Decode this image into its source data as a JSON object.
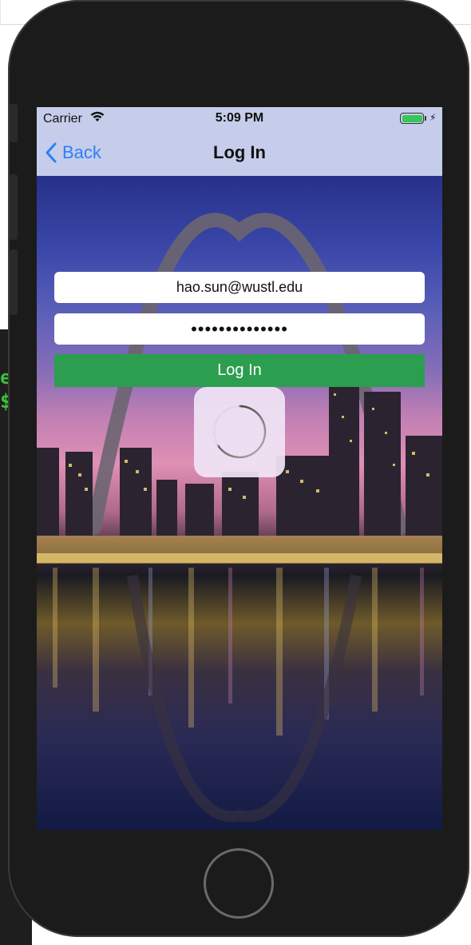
{
  "status_bar": {
    "carrier": "Carrier",
    "time": "5:09 PM"
  },
  "nav": {
    "back_label": "Back",
    "title": "Log In"
  },
  "form": {
    "email_value": "hao.sun@wustl.edu",
    "password_value": "••••••••••••••",
    "login_button_label": "Log In"
  },
  "desktop_terminal": {
    "line1": "e",
    "line2": "$"
  },
  "colors": {
    "nav_bg": "#c5cdea",
    "accent_blue": "#2d7ff9",
    "login_green": "#2c9e4f",
    "battery_green": "#34c759"
  },
  "icons": [
    "wifi-icon",
    "battery-icon",
    "charging-bolt-icon",
    "chevron-left-icon",
    "activity-spinner-icon"
  ]
}
